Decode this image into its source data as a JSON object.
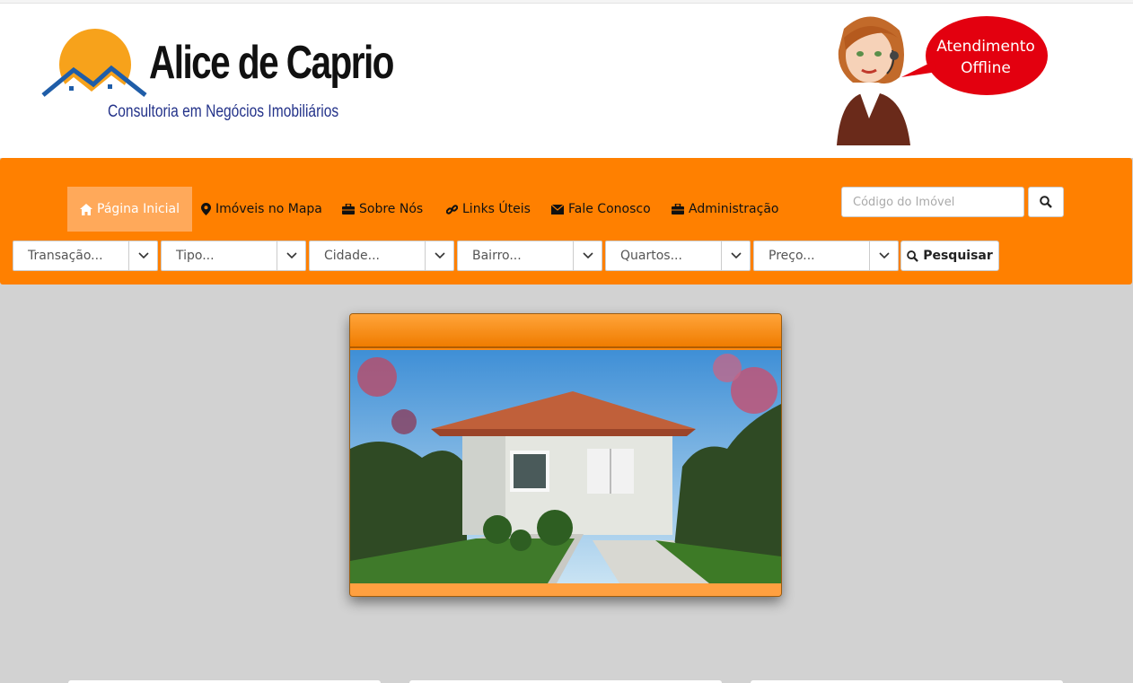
{
  "brand": {
    "name": "Alice de Caprio",
    "tagline": "Consultoria em Negócios Imobiliários"
  },
  "chat": {
    "status_line1": "Atendimento",
    "status_line2": "Offline",
    "bubble_color": "#e3000f"
  },
  "nav": {
    "items": [
      {
        "label": "Página Inicial",
        "icon": "home-icon",
        "active": true
      },
      {
        "label": "Imóveis no Mapa",
        "icon": "map-marker-icon"
      },
      {
        "label": "Sobre Nós",
        "icon": "briefcase-icon"
      },
      {
        "label": "Links Úteis",
        "icon": "link-icon"
      },
      {
        "label": "Fale Conosco",
        "icon": "envelope-icon"
      },
      {
        "label": "Administração",
        "icon": "briefcase-icon"
      }
    ],
    "code_search": {
      "placeholder": "Código do Imóvel",
      "value": ""
    }
  },
  "filters": {
    "selects": [
      {
        "label": "Transação..."
      },
      {
        "label": "Tipo..."
      },
      {
        "label": "Cidade..."
      },
      {
        "label": "Bairro..."
      },
      {
        "label": "Quartos..."
      },
      {
        "label": "Preço..."
      }
    ],
    "search_label": "Pesquisar"
  },
  "colors": {
    "accent": "#ff8000",
    "active_nav": "#ffa95a",
    "background": "#d2d2d2"
  }
}
